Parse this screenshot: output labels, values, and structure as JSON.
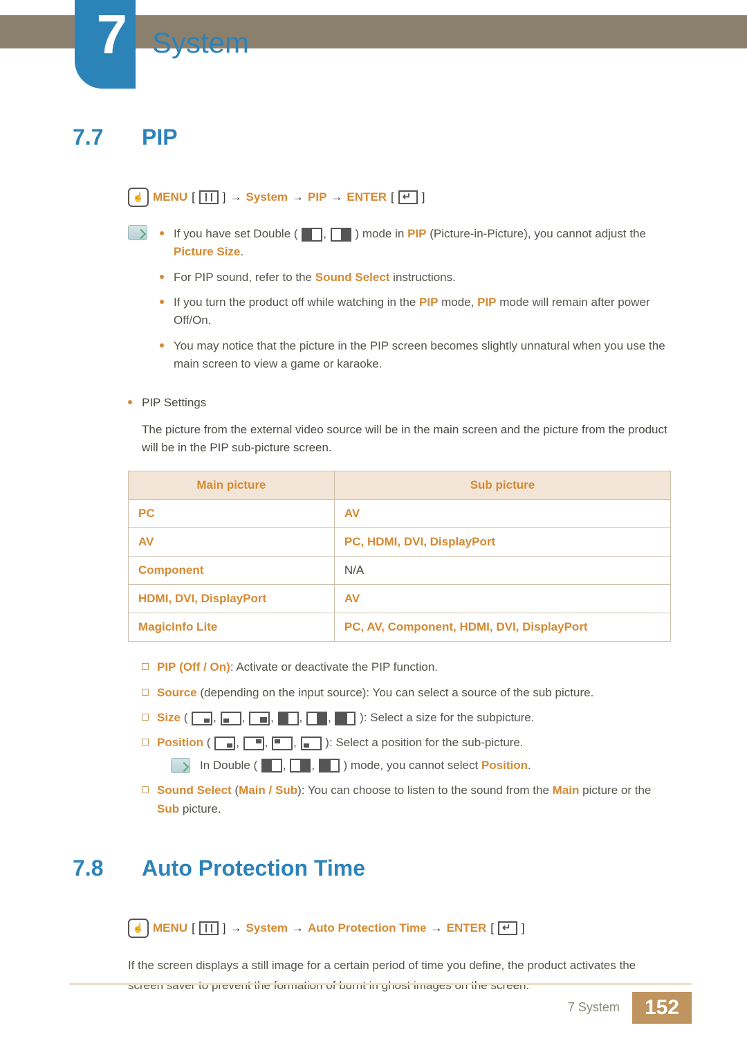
{
  "chapter": {
    "number": "7",
    "title": "System"
  },
  "section1": {
    "num": "7.7",
    "name": "PIP",
    "nav": {
      "menu": "MENU",
      "path": [
        "System",
        "PIP"
      ],
      "enter": "ENTER"
    },
    "notes": [
      {
        "pre": "If you have set Double (",
        "mid_html": "icons2",
        "post1": ") mode in ",
        "kw1": "PIP",
        "post2": " (Picture-in-Picture), you cannot adjust the ",
        "kw2": "Picture Size",
        "post3": "."
      },
      {
        "pre": "For PIP sound, refer to the ",
        "kw1": "Sound Select",
        "post1": " instructions.",
        "simple": true
      },
      {
        "pre": "If you turn the product off while watching in the ",
        "kw1": "PIP",
        "mid": " mode, ",
        "kw2": "PIP",
        "post": " mode will remain after power Off/On."
      },
      {
        "plain": "You may notice that the picture in the PIP screen becomes slightly unnatural when you use the main screen to view a game or karaoke."
      }
    ],
    "settings_title": "PIP Settings",
    "settings_desc": "The picture from the external video source will be in the main screen and the picture from the product will be in the PIP sub-picture screen.",
    "table": {
      "head": [
        "Main picture",
        "Sub picture"
      ],
      "rows": [
        {
          "main": "PC",
          "sub": "AV",
          "sub_plain": false
        },
        {
          "main": "AV",
          "sub": "PC, HDMI, DVI, DisplayPort",
          "sub_plain": false
        },
        {
          "main": "Component",
          "sub": "N/A",
          "sub_plain": true
        },
        {
          "main": "HDMI, DVI, DisplayPort",
          "sub": "AV",
          "sub_plain": false
        },
        {
          "main": "MagicInfo Lite",
          "sub": "PC, AV, Component, HDMI, DVI, DisplayPort",
          "sub_plain": false
        }
      ]
    },
    "opts": {
      "pip": {
        "kw": "PIP",
        "paren": "Off / On",
        "rest": ": Activate or deactivate the PIP function."
      },
      "source": {
        "kw": "Source",
        "rest": " (depending on the input source): You can select a source of the sub picture."
      },
      "size": {
        "kw": "Size",
        "rest": "): Select a size for the subpicture."
      },
      "position": {
        "kw": "Position",
        "rest": "): Select a position for the sub-picture."
      },
      "pos_note_pre": "In Double (",
      "pos_note_post": ") mode, you cannot select ",
      "pos_note_kw": "Position",
      "pos_note_end": ".",
      "sound": {
        "kw": "Sound Select",
        "paren": "Main / Sub",
        "rest1": "): You can choose to listen to the sound from the ",
        "kw2": "Main",
        "rest2": " picture or the ",
        "kw3": "Sub",
        "rest3": " picture."
      }
    }
  },
  "section2": {
    "num": "7.8",
    "name": "Auto Protection Time",
    "nav": {
      "menu": "MENU",
      "path": [
        "System",
        "Auto Protection Time"
      ],
      "enter": "ENTER"
    },
    "desc": "If the screen displays a still image for a certain period of time you define, the product activates the screen saver to prevent the formation of burnt in ghost images on the screen."
  },
  "footer": {
    "crumb": "7 System",
    "page": "152"
  }
}
